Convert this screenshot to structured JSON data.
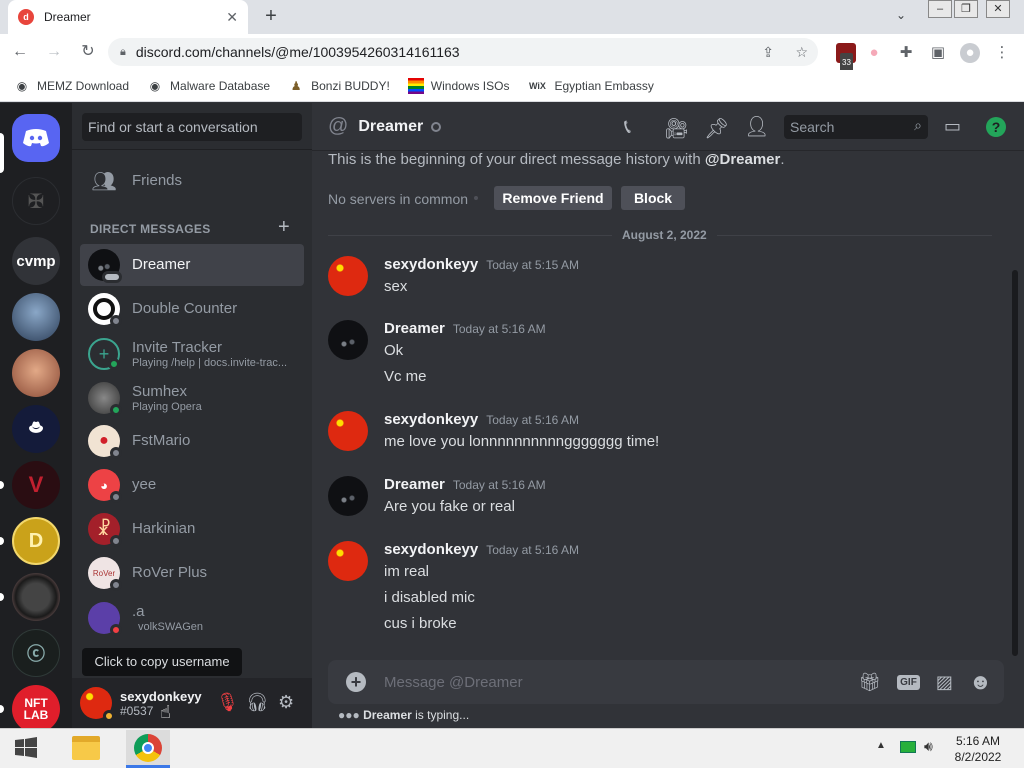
{
  "browser": {
    "tab_title": "Dreamer",
    "url": "discord.com/channels/@me/1003954260314161163",
    "extension_badge": "33",
    "bookmarks": [
      {
        "label": "MEMZ Download",
        "icon": "globe-icon"
      },
      {
        "label": "Malware Database",
        "icon": "globe-icon"
      },
      {
        "label": "Bonzi BUDDY!",
        "icon": "bonzi-icon"
      },
      {
        "label": "Windows ISOs",
        "icon": "rainbow-flag-icon"
      },
      {
        "label": "Egyptian Embassy",
        "icon": "wix-icon"
      }
    ]
  },
  "servers": [
    {
      "label": "",
      "kind": "discord-home"
    },
    {
      "label": "",
      "kind": "dark-emblem"
    },
    {
      "label": "cvmp",
      "kind": "text"
    },
    {
      "label": "",
      "kind": "avatar-blue"
    },
    {
      "label": "",
      "kind": "avatar-face"
    },
    {
      "label": "",
      "kind": "avatar-monopoly"
    },
    {
      "label": "",
      "kind": "avatar-red-v"
    },
    {
      "label": "",
      "kind": "avatar-gold"
    },
    {
      "label": "",
      "kind": "avatar-art"
    },
    {
      "label": "",
      "kind": "avatar-c"
    },
    {
      "label": "NFT LAB",
      "kind": "text-red"
    }
  ],
  "dm": {
    "search_placeholder": "Find or start a conversation",
    "friends_label": "Friends",
    "section_label": "DIRECT MESSAGES",
    "items": [
      {
        "name": "Dreamer",
        "sub": "",
        "status": "typing"
      },
      {
        "name": "Double Counter",
        "sub": "",
        "status": "offline"
      },
      {
        "name": "Invite Tracker",
        "sub": "Playing /help | docs.invite-trac...",
        "status": "online"
      },
      {
        "name": "Sumhex",
        "sub": "Playing Opera",
        "status": "online"
      },
      {
        "name": "FstMario",
        "sub": "",
        "status": "offline"
      },
      {
        "name": "yee",
        "sub": "",
        "status": "offline"
      },
      {
        "name": "Harkinian",
        "sub": "",
        "status": "offline"
      },
      {
        "name": "RoVer Plus",
        "sub": "",
        "status": "offline"
      },
      {
        "name": ".a",
        "sub": "volkSWAGen",
        "status": "dnd"
      }
    ]
  },
  "user": {
    "tooltip": "Click to copy username",
    "name": "sexydonkeyy",
    "tag": "#0537"
  },
  "header": {
    "channel_name": "Dreamer",
    "search_placeholder": "Search"
  },
  "chat": {
    "intro_prefix": "This is the beginning of your direct message history with ",
    "intro_name": "@Dreamer",
    "intro_suffix": ".",
    "no_servers": "No servers in common",
    "remove_friend": "Remove Friend",
    "block": "Block",
    "date_divider": "August 2, 2022",
    "messages": [
      {
        "author": "sexydonkeyy",
        "time": "Today at 5:15 AM",
        "lines": [
          "sex"
        ],
        "avatar": "flag"
      },
      {
        "author": "Dreamer",
        "time": "Today at 5:16 AM",
        "lines": [
          "Ok",
          "Vc me"
        ],
        "avatar": "dark"
      },
      {
        "author": "sexydonkeyy",
        "time": "Today at 5:16 AM",
        "lines": [
          "me love you lonnnnnnnnnnggggggg time!"
        ],
        "avatar": "flag"
      },
      {
        "author": "Dreamer",
        "time": "Today at 5:16 AM",
        "lines": [
          "Are you fake or real"
        ],
        "avatar": "dark"
      },
      {
        "author": "sexydonkeyy",
        "time": "Today at 5:16 AM",
        "lines": [
          "im real",
          "i disabled mic",
          "cus i broke"
        ],
        "avatar": "flag"
      }
    ]
  },
  "composer": {
    "placeholder": "Message @Dreamer",
    "typing_name": "Dreamer",
    "typing_suffix": " is typing..."
  },
  "taskbar": {
    "time": "5:16 AM",
    "date": "8/2/2022"
  }
}
